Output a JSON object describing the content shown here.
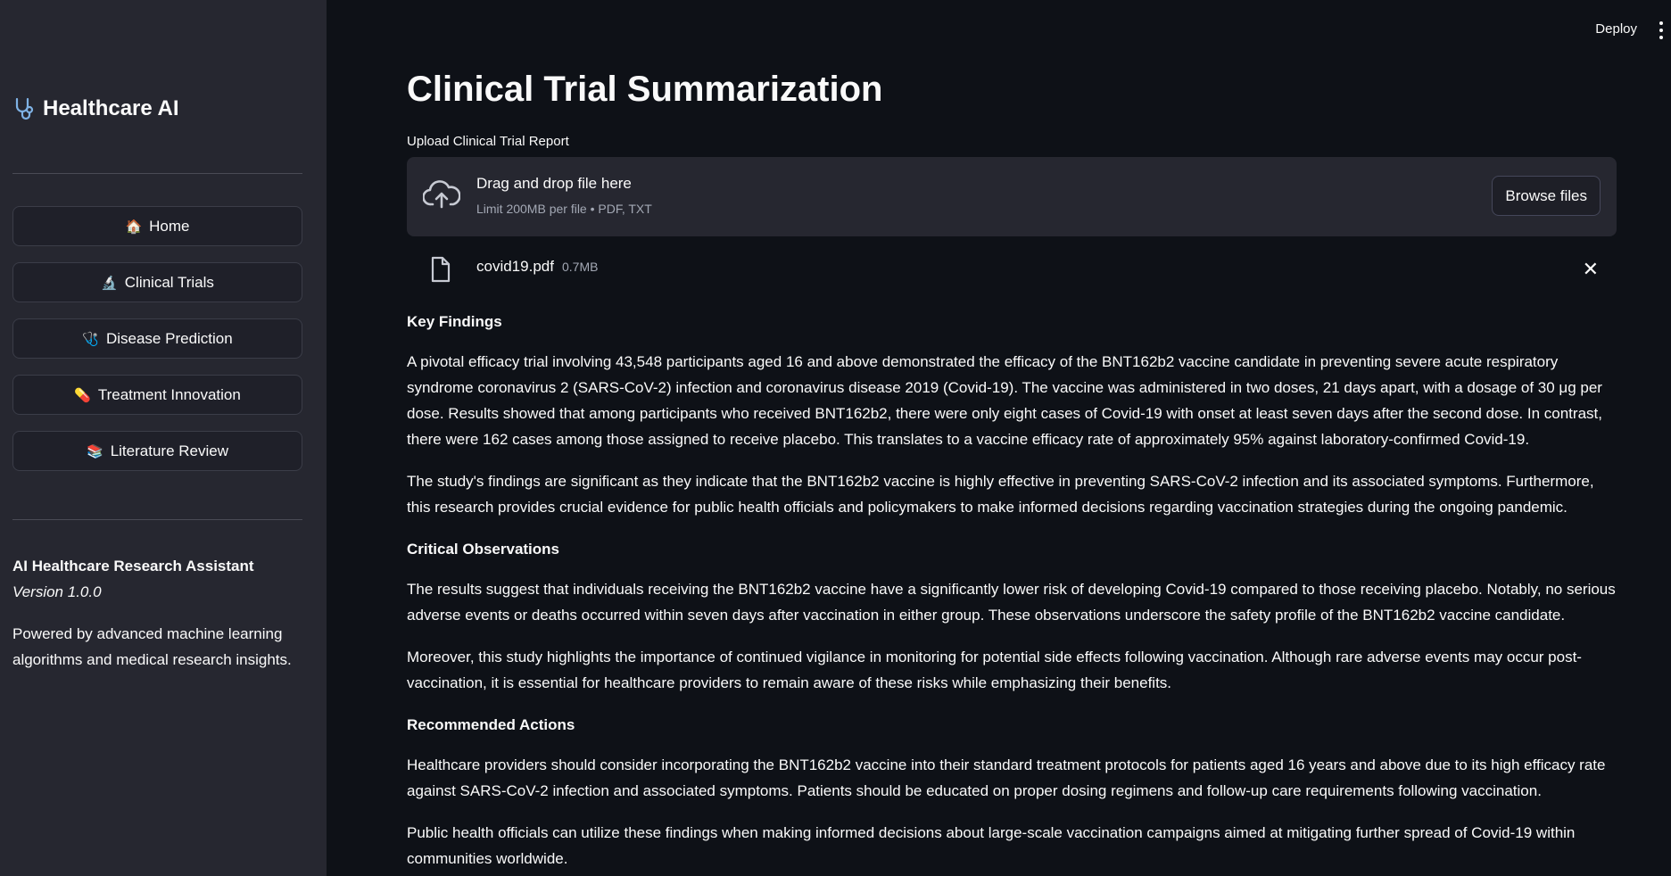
{
  "sidebar": {
    "brand_title": "Healthcare AI",
    "nav": [
      {
        "icon": "🏠",
        "label": "Home"
      },
      {
        "icon": "🔬",
        "label": "Clinical Trials"
      },
      {
        "icon": "🩺",
        "label": "Disease Prediction"
      },
      {
        "icon": "💊",
        "label": "Treatment Innovation"
      },
      {
        "icon": "📚",
        "label": "Literature Review"
      }
    ],
    "footer": {
      "app_name": "AI Healthcare Research Assistant",
      "version": "Version 1.0.0",
      "tagline": "Powered by advanced machine learning algorithms and medical research insights."
    }
  },
  "topbar": {
    "deploy_label": "Deploy"
  },
  "main": {
    "title": "Clinical Trial Summarization",
    "upload": {
      "label": "Upload Clinical Trial Report",
      "drop_text": "Drag and drop file here",
      "limit_text": "Limit 200MB per file • PDF, TXT",
      "browse_label": "Browse files"
    },
    "file": {
      "name": "covid19.pdf",
      "size": "0.7MB"
    },
    "summary": {
      "key_findings_heading": "Key Findings",
      "key_findings_p1": "A pivotal efficacy trial involving 43,548 participants aged 16 and above demonstrated the efficacy of the BNT162b2 vaccine candidate in preventing severe acute respiratory syndrome coronavirus 2 (SARS-CoV-2) infection and coronavirus disease 2019 (Covid-19). The vaccine was administered in two doses, 21 days apart, with a dosage of 30 μg per dose. Results showed that among participants who received BNT162b2, there were only eight cases of Covid-19 with onset at least seven days after the second dose. In contrast, there were 162 cases among those assigned to receive placebo. This translates to a vaccine efficacy rate of approximately 95% against laboratory-confirmed Covid-19.",
      "key_findings_p2": "The study's findings are significant as they indicate that the BNT162b2 vaccine is highly effective in preventing SARS-CoV-2 infection and its associated symptoms. Furthermore, this research provides crucial evidence for public health officials and policymakers to make informed decisions regarding vaccination strategies during the ongoing pandemic.",
      "critical_heading": "Critical Observations",
      "critical_p1": "The results suggest that individuals receiving the BNT162b2 vaccine have a significantly lower risk of developing Covid-19 compared to those receiving placebo. Notably, no serious adverse events or deaths occurred within seven days after vaccination in either group. These observations underscore the safety profile of the BNT162b2 vaccine candidate.",
      "critical_p2": "Moreover, this study highlights the importance of continued vigilance in monitoring for potential side effects following vaccination. Although rare adverse events may occur post-vaccination, it is essential for healthcare providers to remain aware of these risks while emphasizing their benefits.",
      "actions_heading": "Recommended Actions",
      "actions_p1": "Healthcare providers should consider incorporating the BNT162b2 vaccine into their standard treatment protocols for patients aged 16 years and above due to its high efficacy rate against SARS-CoV-2 infection and associated symptoms. Patients should be educated on proper dosing regimens and follow-up care requirements following vaccination.",
      "actions_p2": "Public health officials can utilize these findings when making informed decisions about large-scale vaccination campaigns aimed at mitigating further spread of Covid-19 within communities worldwide."
    }
  }
}
